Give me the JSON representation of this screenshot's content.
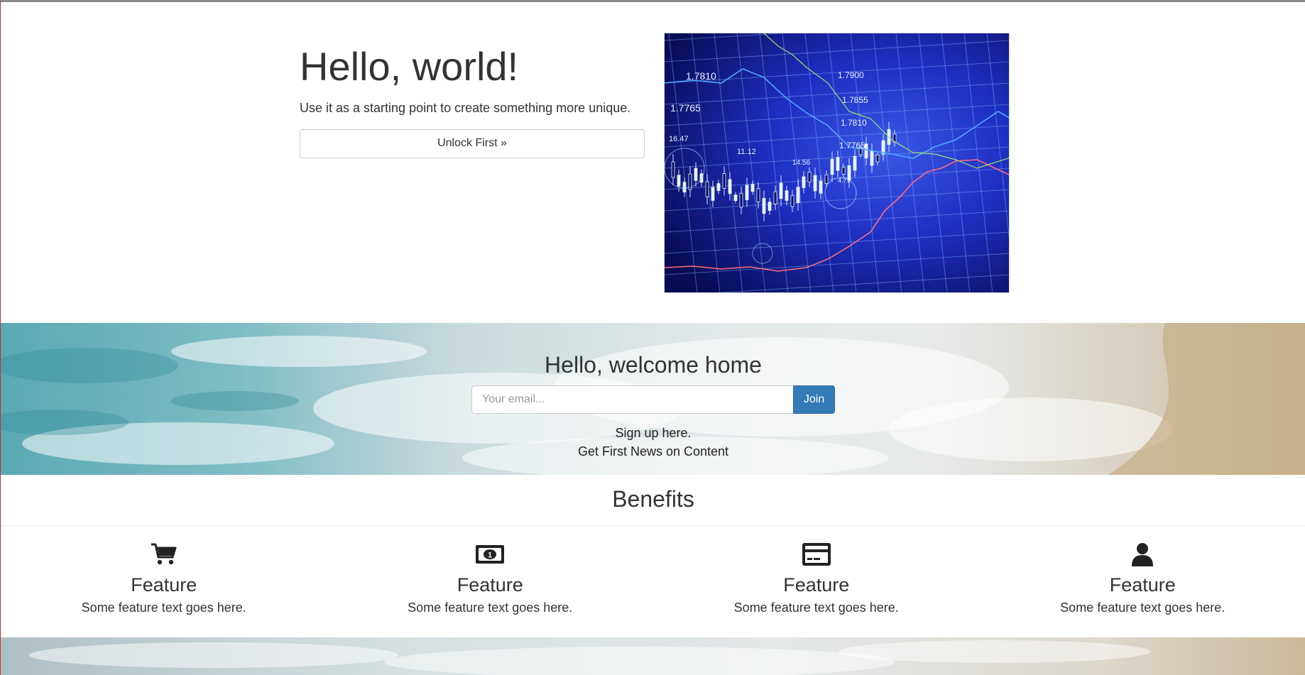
{
  "hero": {
    "title": "Hello, world!",
    "lead": "Use it as a starting point to create something more unique.",
    "button_label": "Unlock First »",
    "image_labels": [
      "1.7810",
      "1.7765",
      "1.7900",
      "1.7855",
      "1.7810",
      "1.7765",
      "11.12",
      "14.56",
      "16.47",
      "4.71"
    ]
  },
  "signup": {
    "title": "Hello, welcome home",
    "email_placeholder": "Your email...",
    "join_label": "Join",
    "note_line1": "Sign up here.",
    "note_line2": "Get First News on Content"
  },
  "benefits": {
    "title": "Benefits",
    "features": [
      {
        "icon": "cart-icon",
        "title": "Feature",
        "text": "Some feature text goes here."
      },
      {
        "icon": "money-icon",
        "title": "Feature",
        "text": "Some feature text goes here."
      },
      {
        "icon": "credit-card-icon",
        "title": "Feature",
        "text": "Some feature text goes here."
      },
      {
        "icon": "user-icon",
        "title": "Feature",
        "text": "Some feature text goes here."
      }
    ]
  },
  "colors": {
    "primary_button": "#337ab7",
    "text": "#333333",
    "chart_background": "#0a1060"
  }
}
